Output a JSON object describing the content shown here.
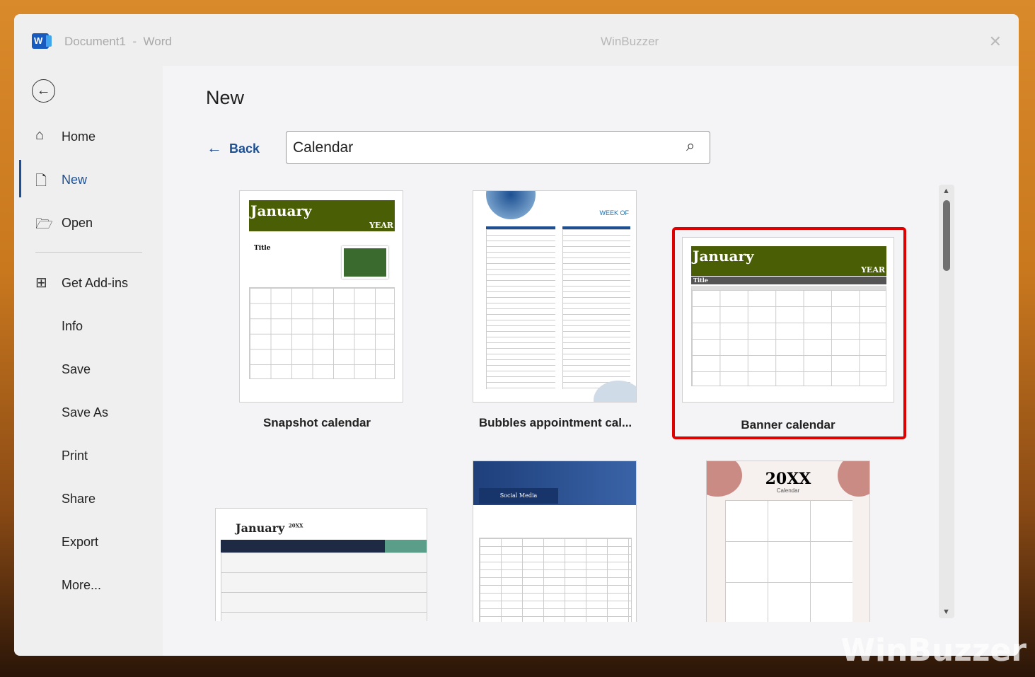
{
  "titlebar": {
    "document": "Document1",
    "separator": "-",
    "app": "Word",
    "watermark": "WinBuzzer",
    "close_icon": "close-icon"
  },
  "sidebar": {
    "back_icon": "back-arrow-circle-icon",
    "items": [
      {
        "label": "Home",
        "icon": "home-icon"
      },
      {
        "label": "New",
        "icon": "document-icon",
        "active": true
      },
      {
        "label": "Open",
        "icon": "folder-icon"
      },
      {
        "label": "Get Add-ins",
        "icon": "grid-icon"
      },
      {
        "label": "Info"
      },
      {
        "label": "Save"
      },
      {
        "label": "Save As"
      },
      {
        "label": "Print"
      },
      {
        "label": "Share"
      },
      {
        "label": "Export"
      },
      {
        "label": "More..."
      }
    ]
  },
  "main": {
    "title": "New",
    "back_label": "Back",
    "search": {
      "value": "Calendar",
      "icon": "search-icon"
    },
    "templates": [
      {
        "name": "Snapshot calendar",
        "preview": {
          "month": "January",
          "year": "YEAR",
          "title": "Title"
        }
      },
      {
        "name": "Bubbles appointment cal...",
        "preview": {
          "heading": "WEEK OF"
        }
      },
      {
        "name": "Banner calendar",
        "selected": true,
        "preview": {
          "month": "January",
          "year": "YEAR",
          "title": "Title"
        }
      },
      {
        "name": "",
        "preview": {
          "month": "January",
          "year": "20XX"
        }
      },
      {
        "name": "",
        "preview": {
          "heading": "Social Media"
        }
      },
      {
        "name": "",
        "preview": {
          "year": "20XX",
          "subtitle": "Calendar"
        }
      }
    ]
  },
  "colors": {
    "accent": "#1d4f91",
    "selection": "#e00000",
    "banner": "#4a5e05"
  },
  "watermark_logo": "WinBuzzer"
}
